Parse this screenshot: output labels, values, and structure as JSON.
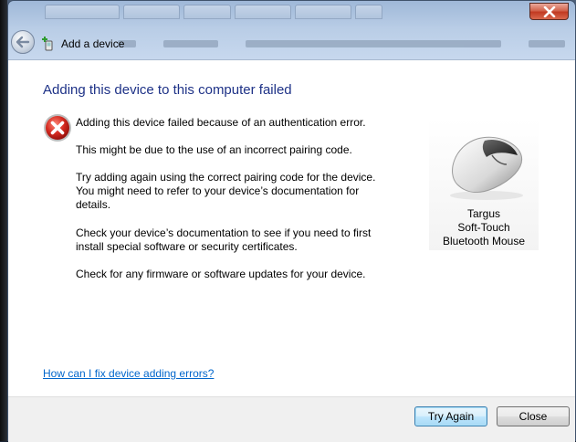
{
  "window": {
    "header_title": "Add a device"
  },
  "main": {
    "title": "Adding this device to this computer failed",
    "messages": [
      "Adding this device failed because of an authentication error.",
      "This might be due to the use of an incorrect pairing code.",
      "Try adding again using the correct pairing code for the device. You might need to refer to your device’s documentation for details.",
      "Check your device’s documentation to see if you need to first install special software or security certificates.",
      "Check for any firmware or software updates for your device."
    ],
    "help_link": "How can I fix device adding errors?"
  },
  "device": {
    "name_lines": [
      "Targus",
      "Soft-Touch",
      "Bluetooth Mouse"
    ],
    "icon": "mouse-icon"
  },
  "buttons": {
    "try_again": "Try Again",
    "close": "Close"
  },
  "colors": {
    "title_blue": "#1e3287",
    "link_blue": "#0066cc",
    "error_red": "#cc1d1d"
  }
}
